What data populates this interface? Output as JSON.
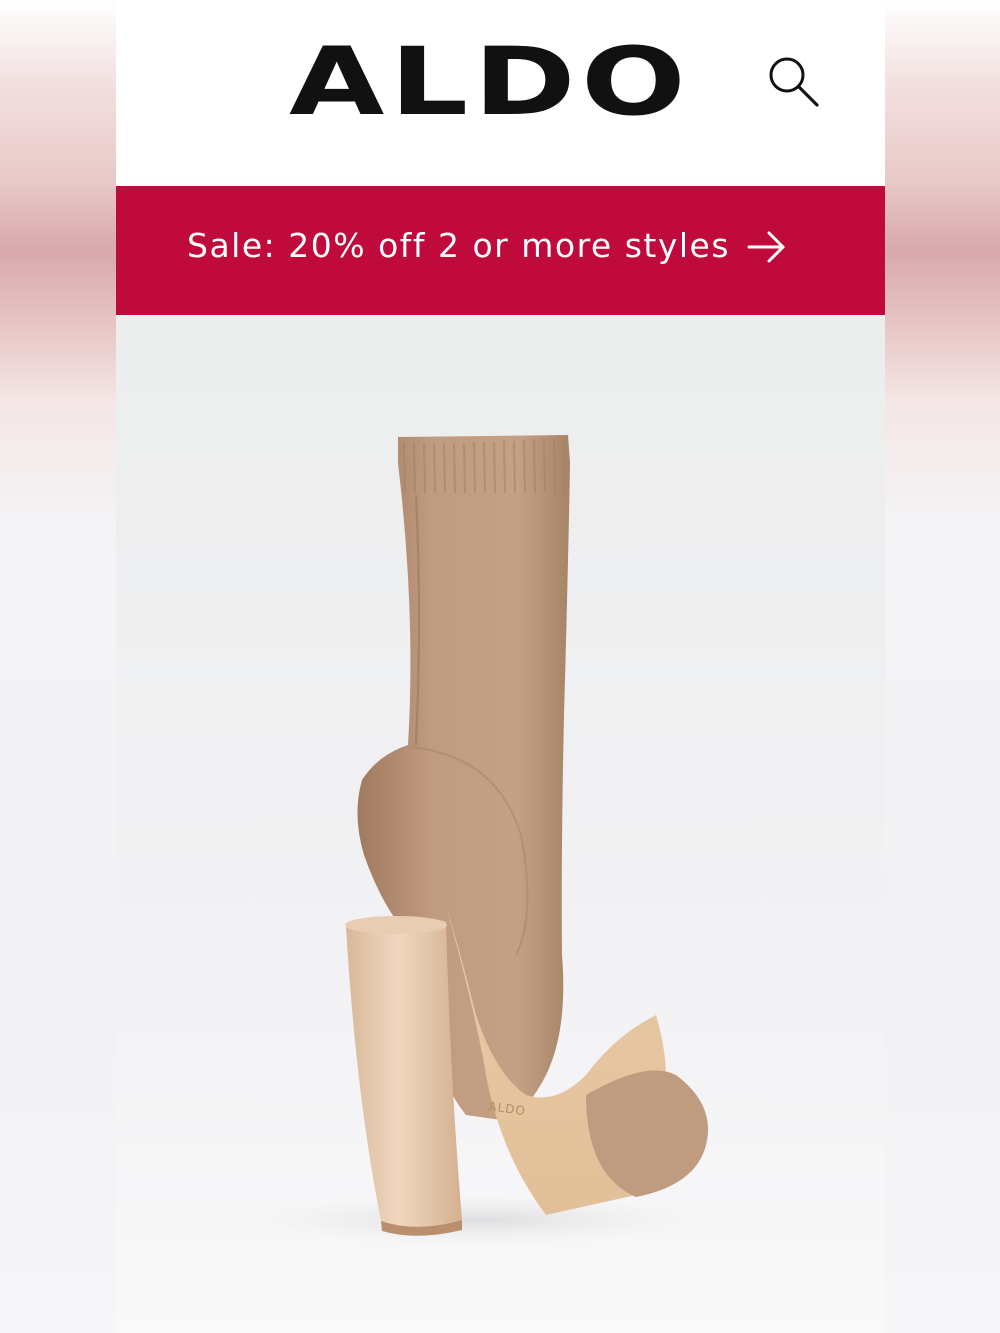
{
  "brand": {
    "name": "ALDO"
  },
  "header": {
    "search_icon": "search-icon"
  },
  "promo_banner": {
    "text": "Sale: 20% off 2 or more styles",
    "arrow_icon": "arrow-right-icon",
    "background_color": "#c00a3b",
    "text_color": "#ffffff"
  },
  "product": {
    "image": "tan-knit-sock-bootie-block-heel",
    "insole_brand": "ALDO"
  }
}
